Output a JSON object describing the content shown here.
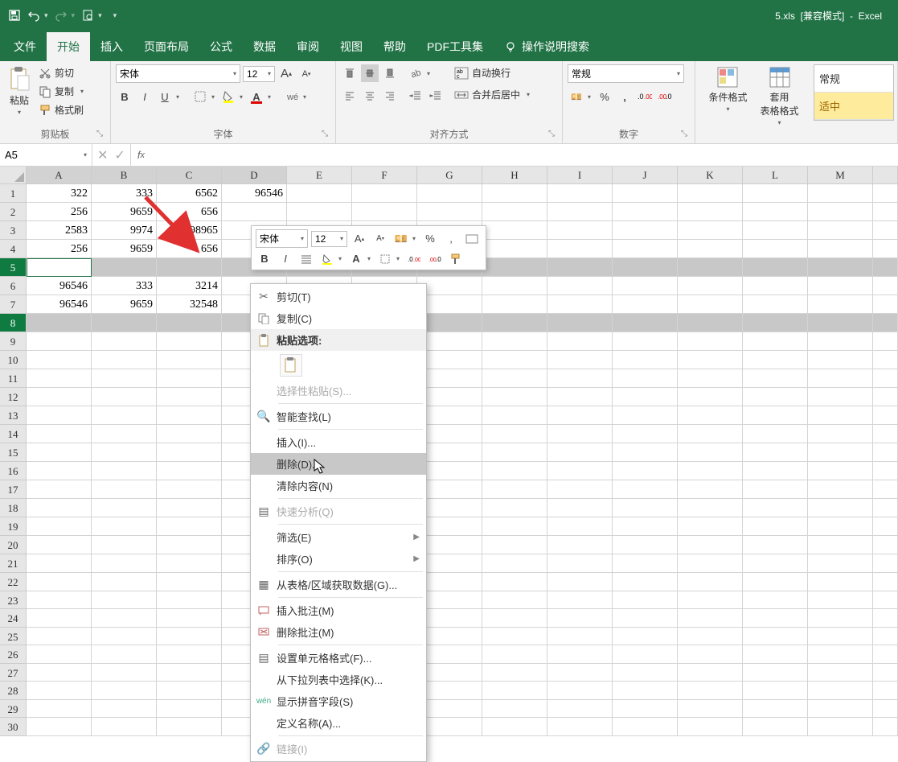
{
  "title": {
    "filename": "5.xls",
    "mode": "[兼容模式]",
    "sep": "-",
    "app": "Excel"
  },
  "qat": {
    "save": "save-icon",
    "undo": "undo-icon",
    "redo": "redo-icon",
    "preview": "print-preview-icon"
  },
  "tabs": [
    "文件",
    "开始",
    "插入",
    "页面布局",
    "公式",
    "数据",
    "审阅",
    "视图",
    "帮助",
    "PDF工具集"
  ],
  "tell_me": "操作说明搜索",
  "ribbon": {
    "clipboard": {
      "paste": "粘贴",
      "cut": "剪切",
      "copy": "复制",
      "fmt": "格式刷",
      "label": "剪贴板"
    },
    "font": {
      "name": "宋体",
      "size": "12",
      "bold": "B",
      "italic": "I",
      "underline": "U",
      "label": "字体"
    },
    "align": {
      "wrap": "自动换行",
      "merge": "合并后居中",
      "label": "对齐方式"
    },
    "number": {
      "format": "常规",
      "percent": "%",
      "comma": ",",
      "label": "数字"
    },
    "styles": {
      "cond": "条件格式",
      "table": "套用\n表格格式",
      "normal": "常规",
      "good": "适中"
    }
  },
  "namebox": "A5",
  "columns": [
    "A",
    "B",
    "C",
    "D",
    "E",
    "F",
    "G",
    "H",
    "I",
    "J",
    "K",
    "L",
    "M"
  ],
  "row_count": 30,
  "selected_rows": [
    5,
    8
  ],
  "active_cell_row": 5,
  "data": {
    "1": {
      "A": "322",
      "B": "333",
      "C": "6562",
      "D": "96546"
    },
    "2": {
      "A": "256",
      "B": "9659",
      "C": "656"
    },
    "3": {
      "A": "2583",
      "B": "9974",
      "C": "98965"
    },
    "4": {
      "A": "256",
      "B": "9659",
      "C": "656"
    },
    "6": {
      "A": "96546",
      "B": "333",
      "C": "3214"
    },
    "7": {
      "A": "96546",
      "B": "9659",
      "C": "32548"
    }
  },
  "mini": {
    "font": "宋体",
    "size": "12",
    "bold": "B",
    "italic": "I",
    "percent": "%",
    "comma": ","
  },
  "ctx": {
    "cut": "剪切(T)",
    "copy": "复制(C)",
    "paste_opts": "粘贴选项:",
    "paste_special": "选择性粘贴(S)...",
    "smart_lookup": "智能查找(L)",
    "insert": "插入(I)...",
    "delete": "删除(D)...",
    "clear": "清除内容(N)",
    "quick": "快速分析(Q)",
    "filter": "筛选(E)",
    "sort": "排序(O)",
    "getdata": "从表格/区域获取数据(G)...",
    "ins_comment": "插入批注(M)",
    "del_comment": "删除批注(M)",
    "fmt_cells": "设置单元格格式(F)...",
    "dropdown": "从下拉列表中选择(K)...",
    "pinyin": "显示拼音字段(S)",
    "defname": "定义名称(A)...",
    "link": "链接(I)"
  }
}
